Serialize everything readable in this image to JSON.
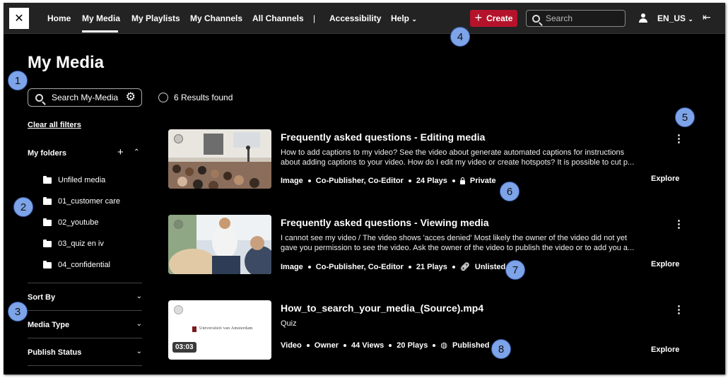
{
  "nav": {
    "items": [
      "Home",
      "My Media",
      "My Playlists",
      "My Channels",
      "All Channels",
      "|",
      "Accessibility",
      "Help"
    ],
    "active": "My Media",
    "create_label": "Create",
    "search_placeholder": "Search",
    "language": "EN_US"
  },
  "page": {
    "title": "My Media"
  },
  "sidebar": {
    "search_placeholder": "Search My-Media",
    "clear_filters": "Clear all filters",
    "folders_title": "My folders",
    "folders": [
      "Unfiled media",
      "01_customer care",
      "02_youtube",
      "03_quiz en iv",
      "04_confidential"
    ],
    "filters": [
      "Sort By",
      "Media Type",
      "Publish Status"
    ]
  },
  "results": {
    "text": "6 Results found"
  },
  "media": [
    {
      "title": "Frequently asked questions - Editing media",
      "desc_line1": "How to add captions to my video? See the video about generate automated captions for instructions",
      "desc_line2": "about adding captions to your video. How do I edit my video or create hotspots? It is possible to cut p...",
      "type": "Image",
      "role": "Co-Publisher, Co-Editor",
      "plays": "24 Plays",
      "status": "Private",
      "explore": "Explore"
    },
    {
      "title": "Frequently asked questions - Viewing media",
      "desc_line1": "I cannot see my video / The video shows 'acces denied' Most likely the owner of the video did not yet",
      "desc_line2": "gave you permission to see the video. Ask the owner of the video to publish the video or to add you a...",
      "type": "Image",
      "role": "Co-Publisher, Co-Editor",
      "plays": "21 Plays",
      "status": "Unlisted",
      "explore": "Explore"
    },
    {
      "title": "How_to_search_your_media_(Source).mp4",
      "desc_line1": "Quiz",
      "type": "Video",
      "role": "Owner",
      "views": "44 Views",
      "plays": "20 Plays",
      "status": "Published",
      "duration": "03:03",
      "thumb_text": "Universiteit van Amsterdam",
      "explore": "Explore"
    }
  ],
  "callouts": [
    "1",
    "2",
    "3",
    "4",
    "5",
    "6",
    "7",
    "8"
  ],
  "colors": {
    "accent": "#b5132b",
    "callout": "#7da3e8",
    "background": "#000000",
    "topbar": "#232323"
  }
}
